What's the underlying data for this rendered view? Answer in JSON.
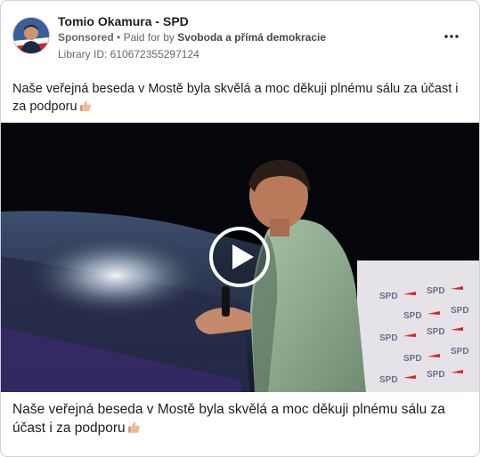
{
  "post": {
    "page_name": "Tomio Okamura - SPD",
    "sponsored_label": "Sponsored",
    "separator": "•",
    "paid_for_prefix": "Paid for by",
    "payer": "Svoboda a přímá demokracie",
    "library_id": "Library ID: 610672355297124",
    "text": "Naše veřejná beseda v Mostě byla skvělá a moc děkuji plnému sálu za účast i za podporu",
    "emoji": "thumbs-up-icon"
  },
  "video": {
    "backdrop_logo_text": "SPD",
    "play_icon": "play-icon"
  },
  "caption": {
    "text": "Naše veřejná beseda v Mostě byla skvělá a moc děkuji plnému sálu za účast i za podporu"
  },
  "colors": {
    "text_primary": "#1c1e21",
    "text_secondary": "#65676b",
    "border": "#cfd3d8",
    "spd_red": "#d9232e",
    "spd_blue": "#1e4fa1"
  }
}
